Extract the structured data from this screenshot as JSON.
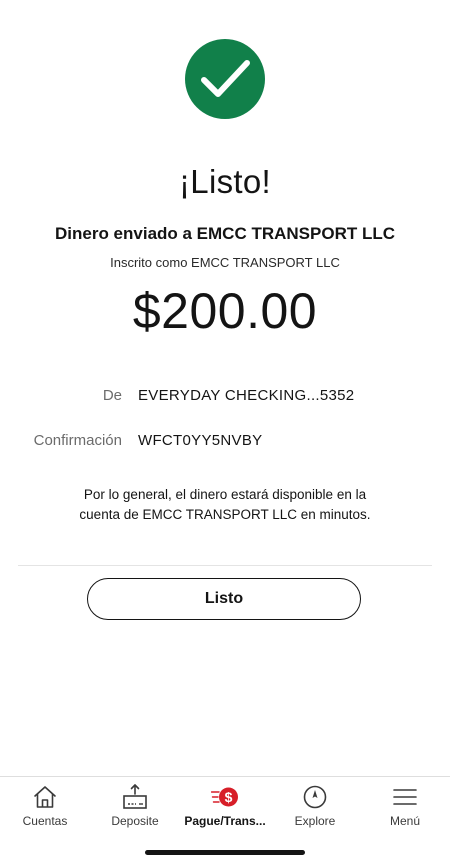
{
  "confirmation_screen": {
    "title": "¡Listo!",
    "sent_to": "Dinero enviado a EMCC TRANSPORT LLC",
    "enrolled_as": "Inscrito como EMCC TRANSPORT LLC",
    "amount": "$200.00",
    "from_label": "De",
    "from_value": "EVERYDAY CHECKING...5352",
    "confirmation_label": "Confirmación",
    "confirmation_value": "WFCT0YY5NVBY",
    "info_line1": "Por lo general, el dinero estará disponible en la",
    "info_line2": "cuenta de EMCC TRANSPORT LLC en minutos.",
    "done_button": "Listo"
  },
  "tab_bar": {
    "items": [
      {
        "label": "Cuentas",
        "icon": "home-icon"
      },
      {
        "label": "Deposite",
        "icon": "deposit-icon"
      },
      {
        "label": "Pague/Trans...",
        "icon": "pay-transfer-icon",
        "active": true
      },
      {
        "label": "Explore",
        "icon": "compass-icon"
      },
      {
        "label": "Menú",
        "icon": "menu-icon"
      }
    ]
  },
  "colors": {
    "success_green": "#11804a",
    "brand_red": "#d71e28",
    "text": "#141414",
    "muted": "#6b6b6b"
  }
}
